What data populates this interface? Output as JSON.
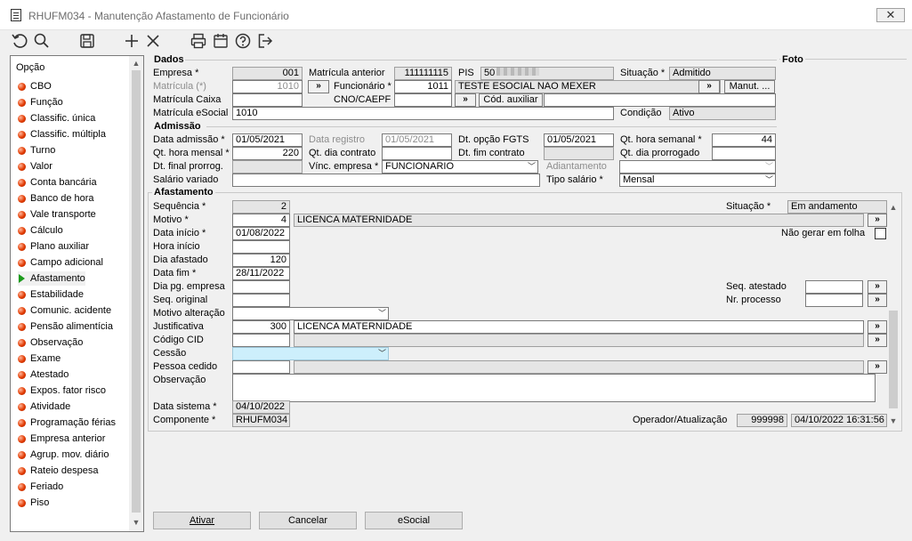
{
  "window": {
    "title": "RHUFM034 - Manutenção Afastamento de Funcionário",
    "close_label": "✕"
  },
  "left_panel": {
    "header": "Opção",
    "items": [
      {
        "label": "CBO"
      },
      {
        "label": "Função"
      },
      {
        "label": "Classific. única"
      },
      {
        "label": "Classific. múltipla"
      },
      {
        "label": "Turno"
      },
      {
        "label": "Valor"
      },
      {
        "label": "Conta bancária"
      },
      {
        "label": "Banco de hora"
      },
      {
        "label": "Vale transporte"
      },
      {
        "label": "Cálculo"
      },
      {
        "label": "Plano auxiliar"
      },
      {
        "label": "Campo adicional"
      },
      {
        "label": "Afastamento",
        "selected": true
      },
      {
        "label": "Estabilidade"
      },
      {
        "label": "Comunic. acidente"
      },
      {
        "label": "Pensão alimentícia"
      },
      {
        "label": "Observação"
      },
      {
        "label": "Exame"
      },
      {
        "label": "Atestado"
      },
      {
        "label": "Expos. fator risco"
      },
      {
        "label": "Atividade"
      },
      {
        "label": "Programação férias"
      },
      {
        "label": "Empresa anterior"
      },
      {
        "label": "Agrup. mov. diário"
      },
      {
        "label": "Rateio despesa"
      },
      {
        "label": "Feriado"
      },
      {
        "label": "Piso"
      }
    ]
  },
  "dados": {
    "title": "Dados",
    "empresa_label": "Empresa *",
    "empresa": "001",
    "matricula_anterior_label": "Matrícula anterior",
    "matricula_anterior": "111111115",
    "pis_label": "PIS",
    "pis": "50",
    "situacao_label": "Situação *",
    "situacao": "Admitido",
    "matricula_label": "Matrícula (*)",
    "matricula": "1010",
    "funcionario_label": "Funcionário *",
    "funcionario": "1011",
    "funcionario_nome": "TESTE ESOCIAL NAO MEXER",
    "manut_label": "Manut. ...",
    "matricula_caixa_label": "Matrícula Caixa",
    "matricula_caixa": "",
    "cno_label": "CNO/CAEPF",
    "cno": "",
    "cod_auxiliar_label": "Cód. auxiliar",
    "cod_auxiliar": "",
    "matricula_esocial_label": "Matrícula eSocial",
    "matricula_esocial": "1010",
    "condicao_label": "Condição",
    "condicao": "Ativo",
    "lookup_label": "»"
  },
  "foto": {
    "title": "Foto"
  },
  "admissao": {
    "title": "Admissão",
    "data_admissao_label": "Data admissão *",
    "data_admissao": "01/05/2021",
    "data_registro_label": "Data registro",
    "data_registro": "01/05/2021",
    "dt_opcao_fgts_label": "Dt. opção FGTS",
    "dt_opcao_fgts": "01/05/2021",
    "qt_hora_semanal_label": "Qt. hora semanal *",
    "qt_hora_semanal": "44",
    "qt_hora_mensal_label": "Qt. hora mensal *",
    "qt_hora_mensal": "220",
    "qt_dia_contrato_label": "Qt. dia contrato",
    "qt_dia_contrato": "",
    "dt_fim_contrato_label": "Dt. fim contrato",
    "dt_fim_contrato": "",
    "qt_dia_prorrogado_label": "Qt. dia prorrogado",
    "qt_dia_prorrogado": "",
    "dt_final_prorrog_label": "Dt. final prorrog.",
    "dt_final_prorrog": "",
    "vinc_empresa_label": "Vínc. empresa *",
    "vinc_empresa": "FUNCIONARIO",
    "adiantamento_label": "Adiantamento",
    "adiantamento": "",
    "salario_variado_label": "Salário variado",
    "salario_variado": "",
    "tipo_salario_label": "Tipo salário *",
    "tipo_salario": "Mensal"
  },
  "afastamento": {
    "title": "Afastamento",
    "sequencia_label": "Sequência *",
    "sequencia": "2",
    "situacao_label": "Situação *",
    "situacao": "Em andamento",
    "motivo_label": "Motivo *",
    "motivo": "4",
    "motivo_desc": "LICENCA MATERNIDADE",
    "data_inicio_label": "Data início *",
    "data_inicio": "01/08/2022",
    "nao_gerar_label": "Não gerar em folha",
    "hora_inicio_label": "Hora início",
    "hora_inicio": "",
    "dia_afastado_label": "Dia afastado",
    "dia_afastado": "120",
    "data_fim_label": "Data fim *",
    "data_fim": "28/11/2022",
    "dia_pg_empresa_label": "Dia pg. empresa",
    "dia_pg_empresa": "",
    "seq_atestado_label": "Seq. atestado",
    "seq_atestado": "",
    "seq_original_label": "Seq. original",
    "seq_original": "",
    "nr_processo_label": "Nr. processo",
    "nr_processo": "",
    "motivo_alteracao_label": "Motivo alteração",
    "motivo_alteracao": "",
    "justificativa_label": "Justificativa",
    "justificativa": "300",
    "justificativa_desc": "LICENCA MATERNIDADE",
    "codigo_cid_label": "Código CID",
    "codigo_cid": "",
    "codigo_cid_desc": "",
    "cessao_label": "Cessão",
    "cessao": "",
    "pessoa_cedido_label": "Pessoa cedido",
    "pessoa_cedido": "",
    "pessoa_cedido_desc": "",
    "observacao_label": "Observação",
    "observacao": "",
    "data_sistema_label": "Data sistema *",
    "data_sistema": "04/10/2022",
    "componente_label": "Componente *",
    "componente": "RHUFM034",
    "operador_label": "Operador/Atualização",
    "operador": "999998",
    "atualizacao": "04/10/2022 16:31:56"
  },
  "footer": {
    "ativar": "Ativar",
    "cancelar": "Cancelar",
    "esocial": "eSocial"
  },
  "toolbar": {
    "icons": [
      "refresh-icon",
      "search-icon",
      "save-icon",
      "add-icon",
      "delete-icon",
      "print-icon",
      "calendar-icon",
      "help-icon",
      "exit-icon"
    ]
  }
}
